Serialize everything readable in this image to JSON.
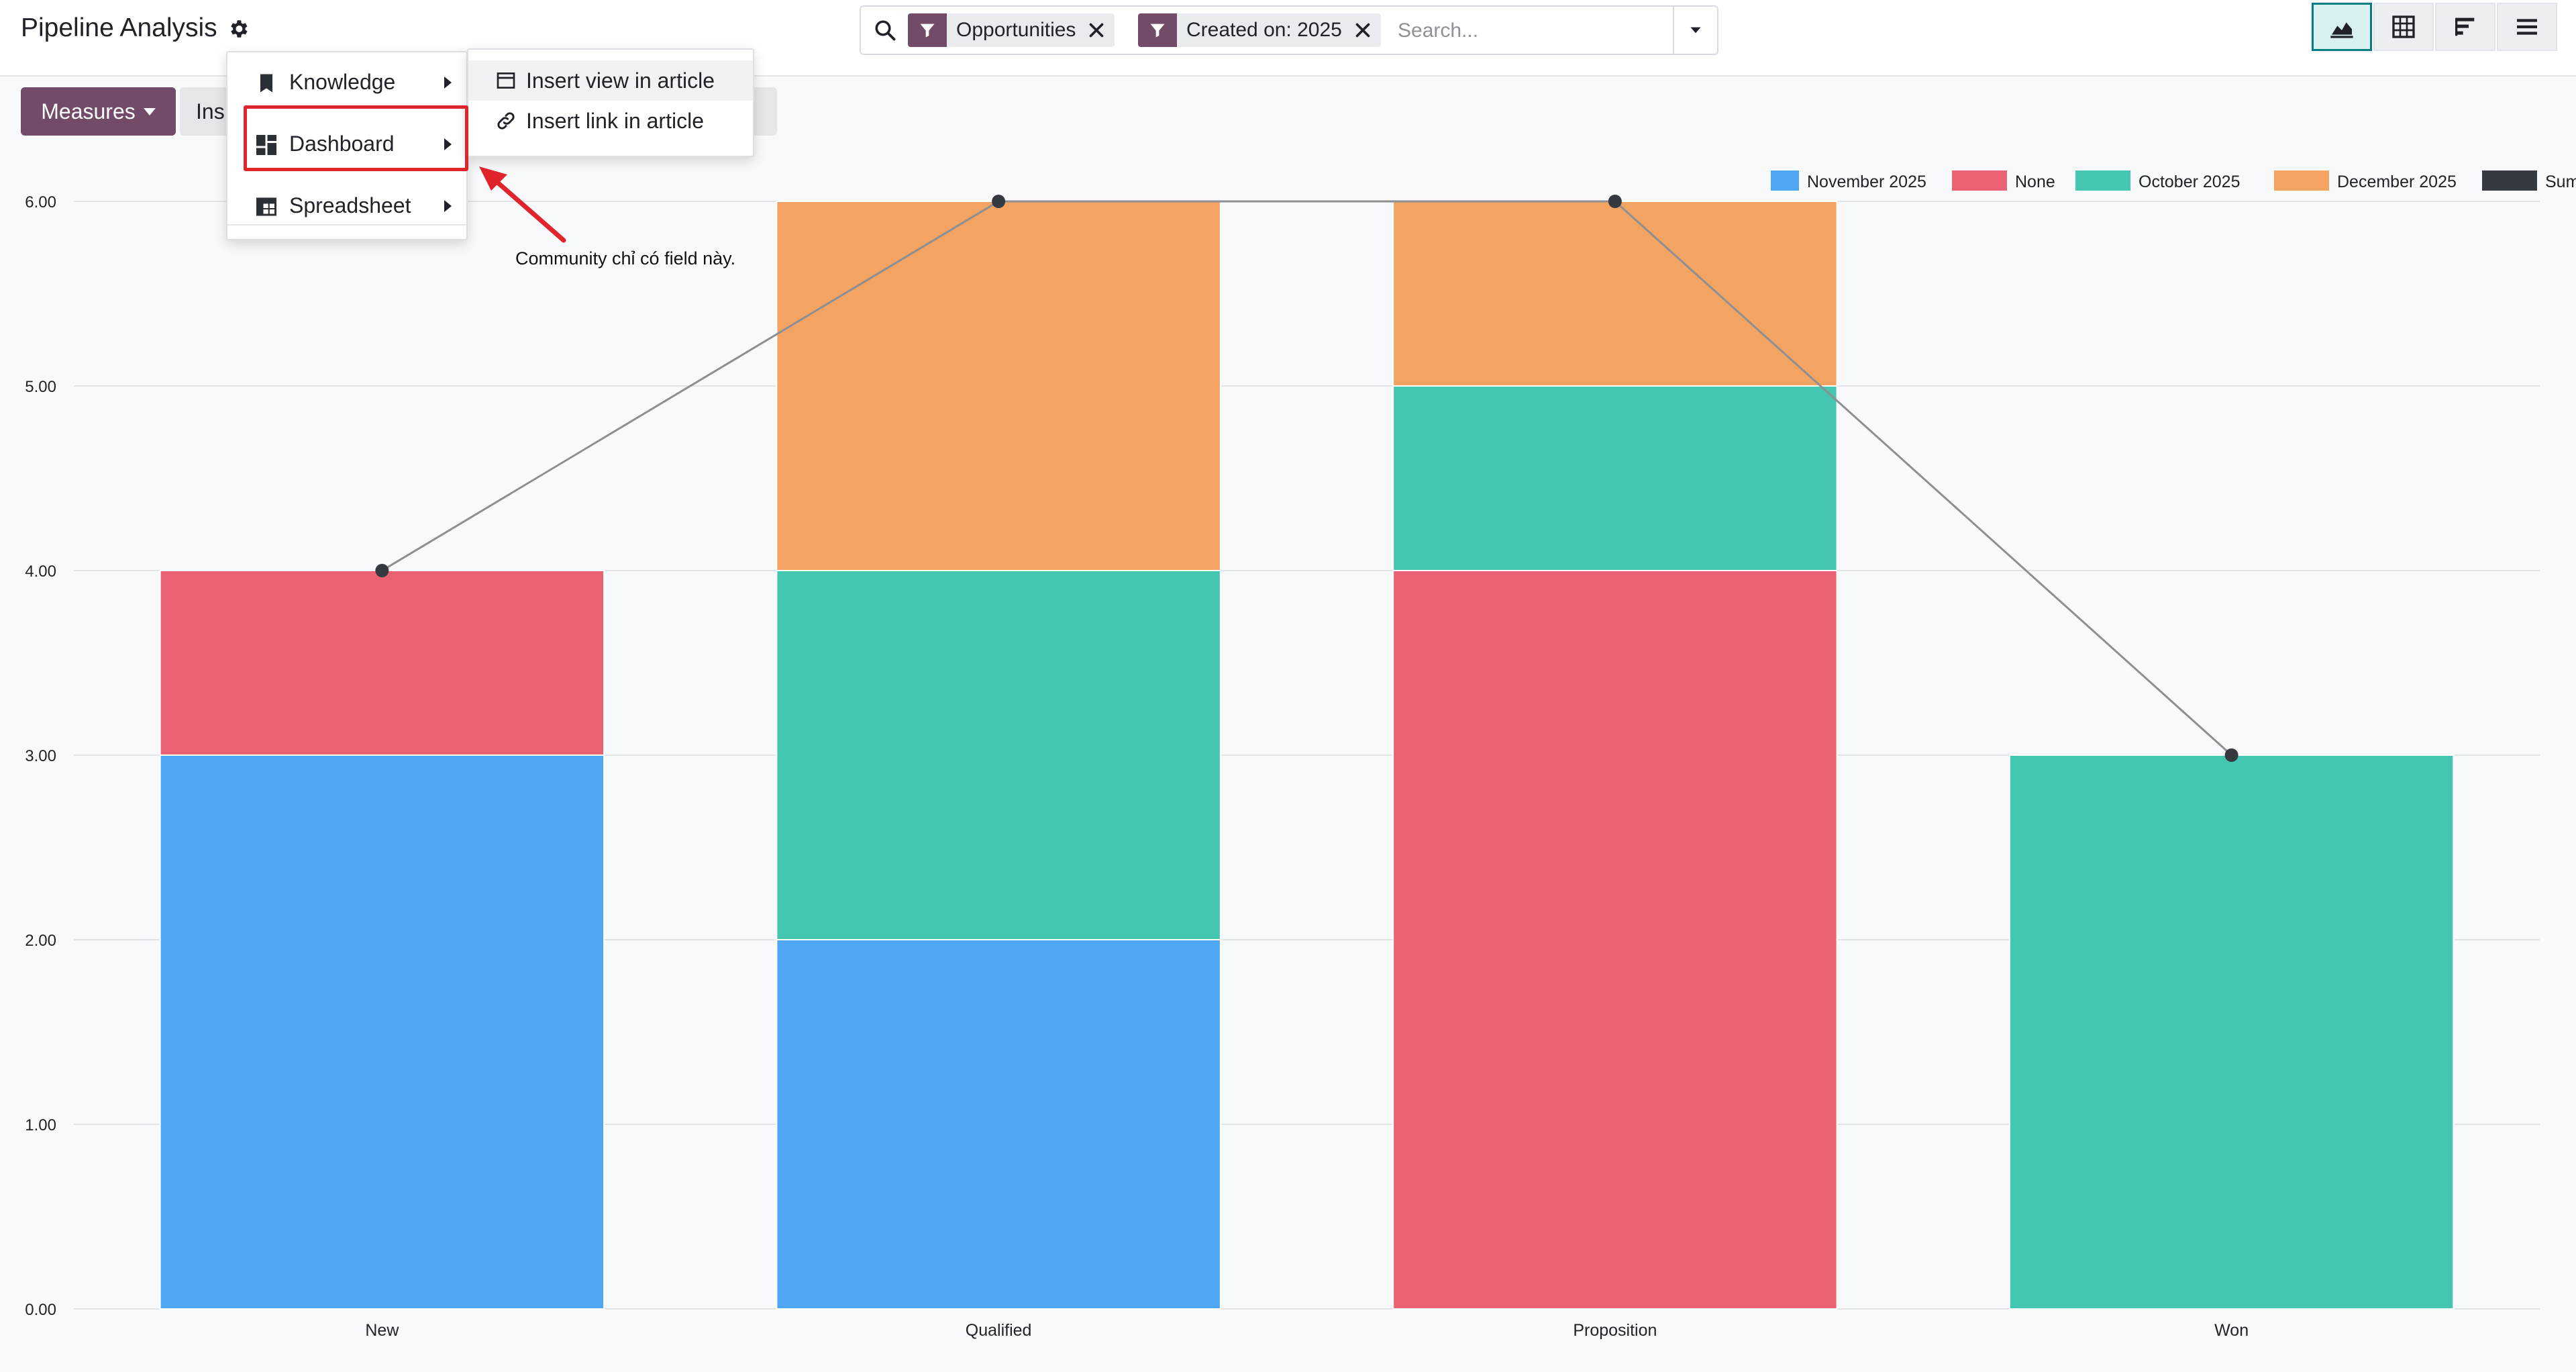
{
  "header": {
    "title": "Pipeline Analysis",
    "search": {
      "facets": [
        {
          "label": "Opportunities"
        },
        {
          "label": "Created on: 2025"
        }
      ],
      "placeholder": "Search..."
    }
  },
  "control_panel": {
    "measures_label": "Measures",
    "insert_label": "Ins"
  },
  "menu": {
    "items": [
      {
        "label": "Knowledge",
        "icon": "bookmark-icon"
      },
      {
        "label": "Dashboard",
        "icon": "dashboard-icon"
      },
      {
        "label": "Spreadsheet",
        "icon": "spreadsheet-icon"
      }
    ],
    "submenu": [
      {
        "label": "Insert view in article",
        "icon": "window-icon"
      },
      {
        "label": "Insert link in article",
        "icon": "link-icon"
      }
    ]
  },
  "annotation": {
    "text": "Community chỉ có field này.",
    "color": "#e0242c"
  },
  "colors": {
    "brand": "#714b67",
    "active_view": "#017e84"
  },
  "chart_data": {
    "type": "bar",
    "stacked": true,
    "categories": [
      "New",
      "Qualified",
      "Proposition",
      "Won"
    ],
    "series": [
      {
        "name": "November 2025",
        "values": [
          3,
          2,
          0,
          0
        ],
        "color": "#4fa6f2"
      },
      {
        "name": "None",
        "values": [
          1,
          0,
          4,
          0
        ],
        "color": "#eb6174"
      },
      {
        "name": "October 2025",
        "values": [
          0,
          2,
          1,
          3
        ],
        "color": "#44c6b0"
      },
      {
        "name": "December 2025",
        "values": [
          0,
          2,
          1,
          0
        ],
        "color": "#f3a362"
      },
      {
        "name": "Sum",
        "type": "line",
        "values": [
          4,
          6,
          6,
          3
        ],
        "color": "#343a40"
      }
    ],
    "yticks": [
      "0.00",
      "1.00",
      "2.00",
      "3.00",
      "4.00",
      "5.00",
      "6.00"
    ],
    "ylim": [
      0,
      6
    ],
    "grid": true,
    "legend": "top-right"
  }
}
